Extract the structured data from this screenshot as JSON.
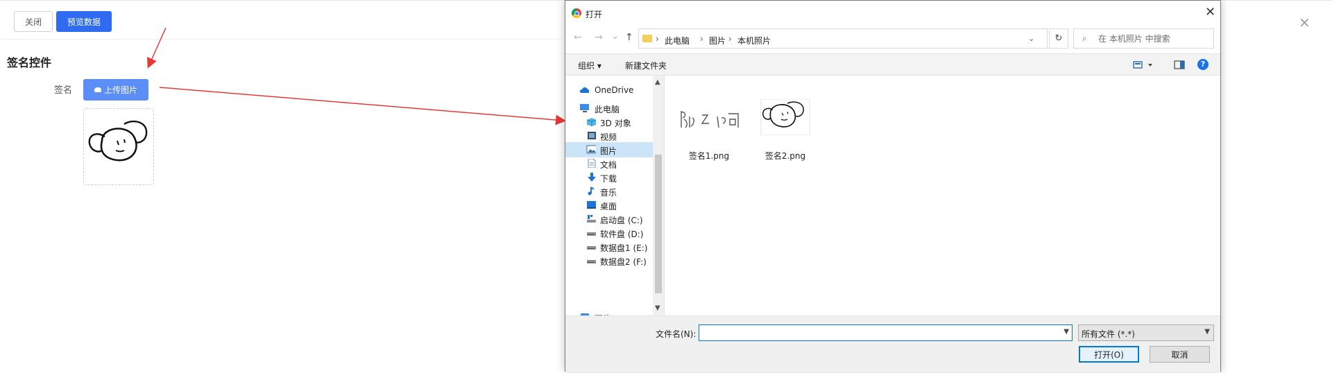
{
  "page": {
    "close_label": "关闭",
    "preview_label": "预览数据",
    "section_title": "签名控件",
    "field_label": "签名",
    "upload_label": "上传图片",
    "close_x": "×"
  },
  "dialog": {
    "title": "打开",
    "close_x": "✕",
    "nav": {
      "back": "←",
      "forward": "→",
      "recent": "⌄",
      "up": "↑"
    },
    "breadcrumb": [
      "此电脑",
      "图片",
      "本机照片"
    ],
    "crumb_sep": "›",
    "address_dropdown": "⌄",
    "refresh": "↻",
    "search_placeholder": "在 本机照片 中搜索",
    "commands": {
      "organize": "组织 ▾",
      "new_folder": "新建文件夹"
    },
    "help": "?",
    "nav_items": [
      {
        "label": "OneDrive",
        "icon": "cloud-icon"
      },
      {
        "label": "此电脑",
        "icon": "computer-icon"
      },
      {
        "label": "3D 对象",
        "icon": "cube-icon"
      },
      {
        "label": "视频",
        "icon": "video-icon"
      },
      {
        "label": "图片",
        "icon": "picture-icon"
      },
      {
        "label": "文档",
        "icon": "document-icon"
      },
      {
        "label": "下载",
        "icon": "download-icon"
      },
      {
        "label": "音乐",
        "icon": "music-icon"
      },
      {
        "label": "桌面",
        "icon": "desktop-icon"
      },
      {
        "label": "启动盘 (C:)",
        "icon": "drive-icon"
      },
      {
        "label": "软件盘 (D:)",
        "icon": "drive-icon"
      },
      {
        "label": "数据盘1 (E:)",
        "icon": "drive-icon"
      },
      {
        "label": "数据盘2 (F:)",
        "icon": "drive-icon"
      },
      {
        "label": "网络",
        "icon": "network-icon"
      }
    ],
    "selected_nav": "图片",
    "files": [
      {
        "name": "签名1.png"
      },
      {
        "name": "签名2.png"
      }
    ],
    "filename_label": "文件名(N):",
    "filename_value": "",
    "filetype": "所有文件 (*.*)",
    "open_label": "打开(O)",
    "cancel_label": "取消"
  },
  "colors": {
    "primary_blue": "#2f6bf0",
    "upload_blue": "#5b8ef7",
    "annotation_red": "#e53935",
    "selection": "#cce4f7"
  }
}
